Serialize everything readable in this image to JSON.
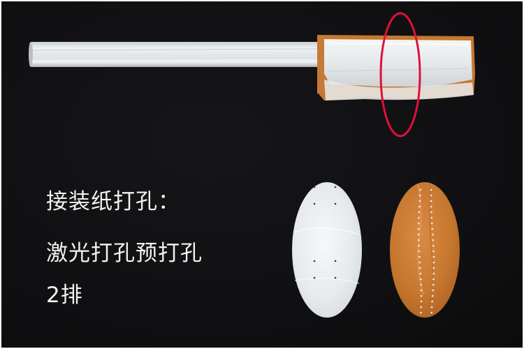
{
  "caption": {
    "title": "接装纸打孔：",
    "line1": "激光打孔预打孔",
    "line2": "2排"
  },
  "colors": {
    "background": "#111113",
    "highlight_ring": "#e0103a",
    "tipping_paper": "#c9772f",
    "filter_white": "#e9edf0",
    "text": "#f2f2f2"
  }
}
